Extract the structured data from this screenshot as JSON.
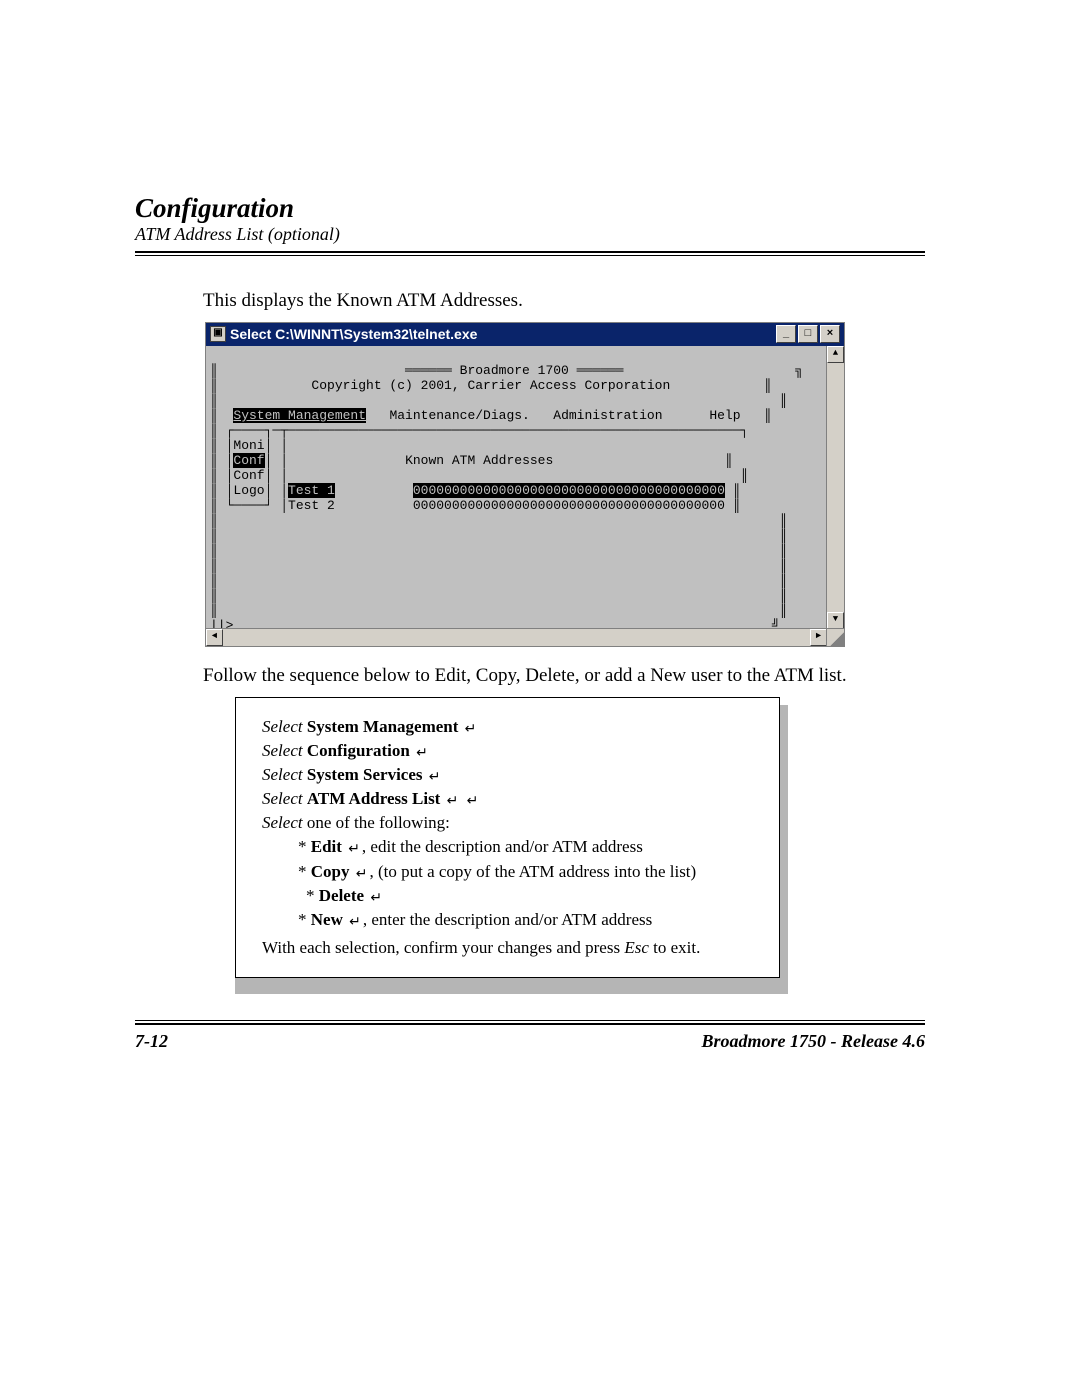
{
  "header": {
    "title": "Configuration",
    "subtitle": "ATM Address List (optional)"
  },
  "intro_text": "This displays the Known ATM Addresses.",
  "telnet": {
    "title": "Select C:\\WINNT\\System32\\telnet.exe",
    "win_buttons": {
      "min": "_",
      "max": "□",
      "close": "×"
    },
    "banner_product": "Broadmore 1700",
    "banner_copyright": "Copyright (c) 2001, Carrier Access Corporation",
    "menu": {
      "system_management": "System Management",
      "maintenance_diags": "Maintenance/Diags.",
      "administration": "Administration",
      "help": "Help"
    },
    "side_menu": {
      "moni": "Moni",
      "conf": "Conf",
      "conf2": "Conf",
      "logo": "Logo"
    },
    "panel_title": "Known ATM Addresses",
    "rows": [
      {
        "name": "Test 1",
        "addr": "0000000000000000000000000000000000000000"
      },
      {
        "name": "Test 2",
        "addr": "0000000000000000000000000000000000000000"
      }
    ],
    "prompt": "||>",
    "scroll": {
      "up": "▲",
      "down": "▼",
      "left": "◄",
      "right": "►"
    }
  },
  "follow_text": "Follow the sequence below to Edit, Copy, Delete, or add a New user to the ATM list.",
  "instructions": {
    "sel": "Select",
    "step1": "System Management",
    "step2": "Configuration",
    "step3": "System Services",
    "step4": "ATM Address List",
    "step5_prefix": "Select",
    "step5_tail": " one of the following:",
    "opt_edit_label": "Edit",
    "opt_edit_tail": ", edit the description and/or ATM address",
    "opt_copy_label": "Copy",
    "opt_copy_tail": ", (to put a copy of the ATM address into the list)",
    "opt_delete_label": "Delete",
    "opt_new_label": "New",
    "opt_new_tail": ",  enter the description and/or ATM address",
    "confirm_pre": "With each selection, confirm your changes and press ",
    "confirm_key": "Esc",
    "confirm_post": " to exit.",
    "bullet": "*",
    "return_glyph": "↵"
  },
  "footer": {
    "page": "7-12",
    "product": "Broadmore 1750 - Release 4.6"
  }
}
